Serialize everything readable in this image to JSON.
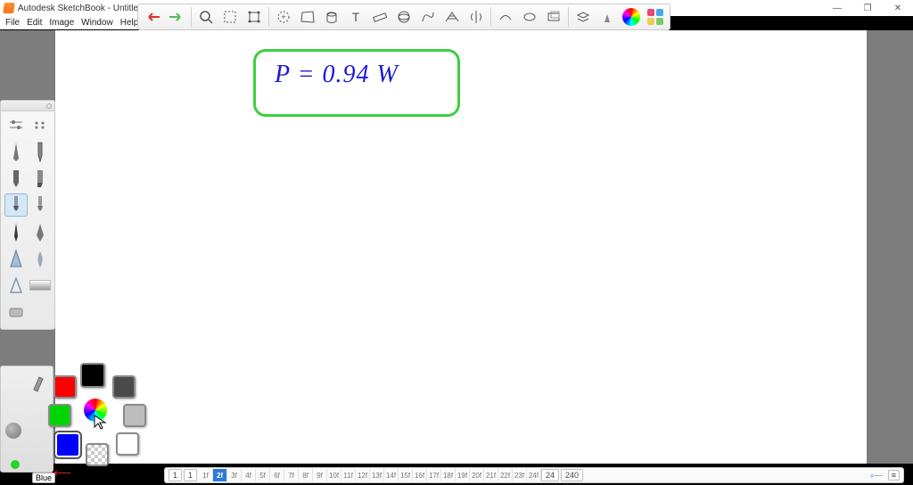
{
  "window": {
    "app_title": "Autodesk SketchBook - Untitled",
    "controls": {
      "minimize": "—",
      "maximize": "❐",
      "close": "✕"
    }
  },
  "menu": {
    "items": [
      "File",
      "Edit",
      "Image",
      "Window",
      "Help"
    ]
  },
  "toolbar": {
    "undo": "undo",
    "redo": "redo",
    "zoom": "zoom",
    "crop": "crop",
    "transform": "transform",
    "addsel": "lasso-add",
    "rect": "rectangle",
    "bucket": "bucket",
    "text": "text",
    "ruler": "ruler",
    "ellipse-guide": "ellipse-guide",
    "french": "french-curve",
    "perspective": "perspective",
    "symmetry": "symmetry",
    "stroke": "predictive-stroke",
    "shape-ellipse": "ellipse",
    "shape-rect": "shape-rect",
    "layers": "layers",
    "brush": "brush",
    "color": "color-wheel",
    "library": "library"
  },
  "canvas": {
    "formula": "P = 0.94 W",
    "box_color": "#3ecf3e",
    "ink_color": "#1b1bd6"
  },
  "brush_palette": {
    "rows": [
      [
        "slider-icon",
        "dots-icon"
      ],
      [
        "pencil",
        "tech-pen"
      ],
      [
        "marker",
        "chisel"
      ],
      [
        "brush-soft",
        "brush-hard"
      ],
      [
        "ink",
        "nib"
      ],
      [
        "cone",
        "drop"
      ],
      [
        "triangle",
        "gradient"
      ],
      [
        "barrel",
        ""
      ]
    ],
    "selected": "brush-soft"
  },
  "swatches": {
    "tooltip": "Blue",
    "colors": {
      "black": "#000000",
      "red": "#ff0000",
      "darkgray": "#4a4a4a",
      "green": "#00d400",
      "lightgray": "#bdbdbd",
      "blue": "#0000ff",
      "white": "#ffffff",
      "checker": "checker"
    },
    "selected": "blue"
  },
  "timeline": {
    "start": "1",
    "pos": "1",
    "current": "2f",
    "frames": [
      "1f",
      "2f",
      "3f",
      "4f",
      "5f",
      "6f",
      "7f",
      "8f",
      "9f",
      "10f",
      "11f",
      "12f",
      "13f",
      "14f",
      "15f",
      "16f",
      "17f",
      "18f",
      "19f",
      "20f",
      "21f",
      "22f",
      "23f",
      "24f"
    ],
    "end": "24",
    "total": "240"
  }
}
